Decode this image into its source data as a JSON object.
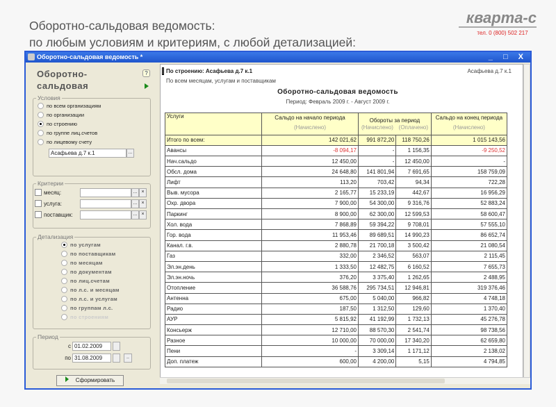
{
  "slide": {
    "title1": "Оборотно-сальдовая ведомость:",
    "title2": "по любым условиям и критериям, с любой детализацией:"
  },
  "logo": {
    "name": "кварта-с",
    "phone": "тел. 0 (800) 502 217"
  },
  "window": {
    "title": "Оборотно-сальдовая ведомость *",
    "controls": "_ □ X"
  },
  "left": {
    "title": "Оборотно-сальдовая",
    "help": "?",
    "conditions": {
      "label": "Условия",
      "options": [
        "по всем организациям",
        "по организации",
        "по строению",
        "по группе лиц.счетов",
        "по лицевому счету"
      ],
      "selected": 2,
      "value": "Асафьева д.7 к.1",
      "btn": "..."
    },
    "criteria": {
      "label": "Критерии",
      "items": [
        "месяц:",
        "услуга:",
        "поставщик:"
      ],
      "btn": "...",
      "clear": "×"
    },
    "detail": {
      "label": "Детализация",
      "options": [
        "по услугам",
        "по поставщикам",
        "по месяцам",
        "по документам",
        "по лиц.счетам",
        "по л.с. и месяцам",
        "по л.с. и услугам",
        "по группам л.с.",
        "по строениям"
      ],
      "selected": 0
    },
    "period": {
      "label": "Период",
      "from_label": "с",
      "from": "01.02.2009",
      "to_label": "по",
      "to": "31.08.2009",
      "btn": ".."
    },
    "generate": "Сформировать"
  },
  "report": {
    "building": "По строению: Асафьева д.7 к.1",
    "building_right": "Асафьева д.7 к.1",
    "scope": "По всем месяцам, услугам и поставщикам",
    "title": "Оборотно-сальдовая ведомость",
    "period": "Период: Февраль 2009 г. - Август 2009 г.",
    "headers": {
      "service": "Услуги",
      "start": "Сальдо на начало периода",
      "turnover": "Обороты за период",
      "end": "Сальдо на конец периода",
      "accrued": "(Начислено)",
      "paid": "(Оплачено)"
    },
    "total": [
      "Итого по всем:",
      "142 021,62",
      "991 872,20",
      "118 750,26",
      "1 015 143,56"
    ],
    "rows": [
      [
        "Авансы",
        "-8 094,17",
        "-",
        "1 156,35",
        "-9 250,52"
      ],
      [
        "Нач.сальдо",
        "12 450,00",
        "-",
        "12 450,00",
        "-"
      ],
      [
        "Обсл. дома",
        "24 648,80",
        "141 801,94",
        "7 691,65",
        "158 759,09"
      ],
      [
        "Лифт",
        "113,20",
        "703,42",
        "94,34",
        "722,28"
      ],
      [
        "Выв. мусора",
        "2 165,77",
        "15 233,19",
        "442,67",
        "16 956,29"
      ],
      [
        "Охр. двора",
        "7 900,00",
        "54 300,00",
        "9 316,76",
        "52 883,24"
      ],
      [
        "Паркинг",
        "8 900,00",
        "62 300,00",
        "12 599,53",
        "58 600,47"
      ],
      [
        "Хол. вода",
        "7 868,89",
        "59 394,22",
        "9 708,01",
        "57 555,10"
      ],
      [
        "Гор. вода",
        "11 953,46",
        "89 689,51",
        "14 990,23",
        "86 652,74"
      ],
      [
        "Канал. г.в.",
        "2 880,78",
        "21 700,18",
        "3 500,42",
        "21 080,54"
      ],
      [
        "Газ",
        "332,00",
        "2 346,52",
        "563,07",
        "2 115,45"
      ],
      [
        "Эл.эн.день",
        "1 333,50",
        "12 482,75",
        "6 160,52",
        "7 655,73"
      ],
      [
        "Эл.эн.ночь",
        "376,20",
        "3 375,40",
        "1 262,65",
        "2 488,95"
      ],
      [
        "Отопление",
        "36 588,76",
        "295 734,51",
        "12 946,81",
        "319 376,46"
      ],
      [
        "Антенна",
        "675,00",
        "5 040,00",
        "966,82",
        "4 748,18"
      ],
      [
        "Радио",
        "187,50",
        "1 312,50",
        "129,60",
        "1 370,40"
      ],
      [
        "АУР",
        "5 815,92",
        "41 192,99",
        "1 732,13",
        "45 276,78"
      ],
      [
        "Консьерж",
        "12 710,00",
        "88 570,30",
        "2 541,74",
        "98 738,56"
      ],
      [
        "Разное",
        "10 000,00",
        "70 000,00",
        "17 340,20",
        "62 659,80"
      ],
      [
        "Пени",
        "-",
        "3 309,14",
        "1 171,12",
        "2 138,02"
      ],
      [
        "Доп. платеж",
        "600,00",
        "4 200,00",
        "5,15",
        "4 794,85"
      ]
    ]
  }
}
